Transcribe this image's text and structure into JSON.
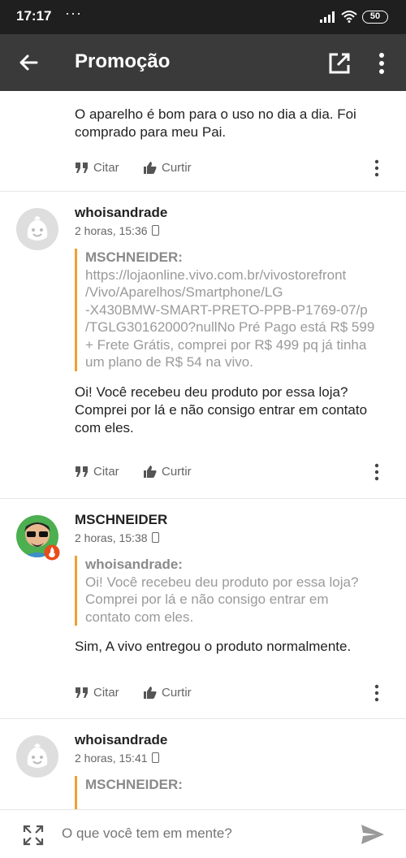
{
  "status_bar": {
    "time": "17:17",
    "dots": "···",
    "battery": "50"
  },
  "app_bar": {
    "title": "Promoção"
  },
  "actions": {
    "quote_label": "Citar",
    "like_label": "Curtir"
  },
  "posts": [
    {
      "body": "O aparelho é bom para o uso no dia a dia. Foi comprado para meu Pai."
    },
    {
      "author": "whoisandrade",
      "time": "2 horas, 15:36",
      "quote_author": "MSCHNEIDER:",
      "quote_lines": [
        "https://lojaonline.vivo.com.br/vivostorefront",
        "/Vivo/Aparelhos/Smartphone/LG",
        "-X430BMW-SMART-PRETO-PPB-P1769-07/p",
        "/TGLG30162000?nullNo Pré Pago está R$ 599",
        "+ Frete Grátis, comprei por R$ 499 pq já tinha",
        "um plano de R$ 54 na vivo."
      ],
      "body_lines": [
        "Oi! Você recebeu deu produto por essa loja?",
        "Comprei por lá e não consigo entrar em contato",
        "com eles."
      ]
    },
    {
      "author": "MSCHNEIDER",
      "time": "2 horas, 15:38",
      "quote_author": "whoisandrade:",
      "quote_lines": [
        "Oi! Você recebeu deu produto por essa loja?",
        "Comprei por lá e não consigo entrar em",
        "contato com eles."
      ],
      "body": "Sim, A vivo entregou o produto normalmente."
    },
    {
      "author": "whoisandrade",
      "time": "2 horas, 15:41",
      "quote_author": "MSCHNEIDER:"
    }
  ],
  "composer": {
    "placeholder": "O que você tem em mente?"
  },
  "colors": {
    "app_bar": "#3a3a3a",
    "status_bar": "#1f1f1f",
    "quote_accent": "#f0a030"
  }
}
